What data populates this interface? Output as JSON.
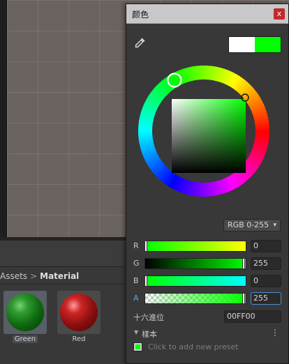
{
  "picker": {
    "title": "颜色",
    "close_glyph": "x",
    "eyedropper_icon": "eyedropper-icon",
    "swatch": {
      "previous_color": "#ffffff",
      "current_color": "#00ff00"
    },
    "mode_label": "RGB 0-255",
    "mode_arrow": "▾",
    "channels": [
      {
        "label": "R",
        "value": "0"
      },
      {
        "label": "G",
        "value": "255"
      },
      {
        "label": "B",
        "value": "0"
      },
      {
        "label": "A",
        "value": "255"
      }
    ],
    "hex_label": "十六進位",
    "hex_value": "00FF00",
    "presets_fold_glyph": "▼",
    "presets_label": "樣本",
    "presets_menu_glyph": "⋮",
    "preset_add_text": "Click to add new preset"
  },
  "project": {
    "breadcrumb": {
      "parent": "Assets",
      "separator": ">",
      "current": "Material"
    },
    "assets": [
      {
        "label": "Green",
        "color": "#109a10"
      },
      {
        "label": "Red",
        "color": "#b81818"
      }
    ]
  }
}
